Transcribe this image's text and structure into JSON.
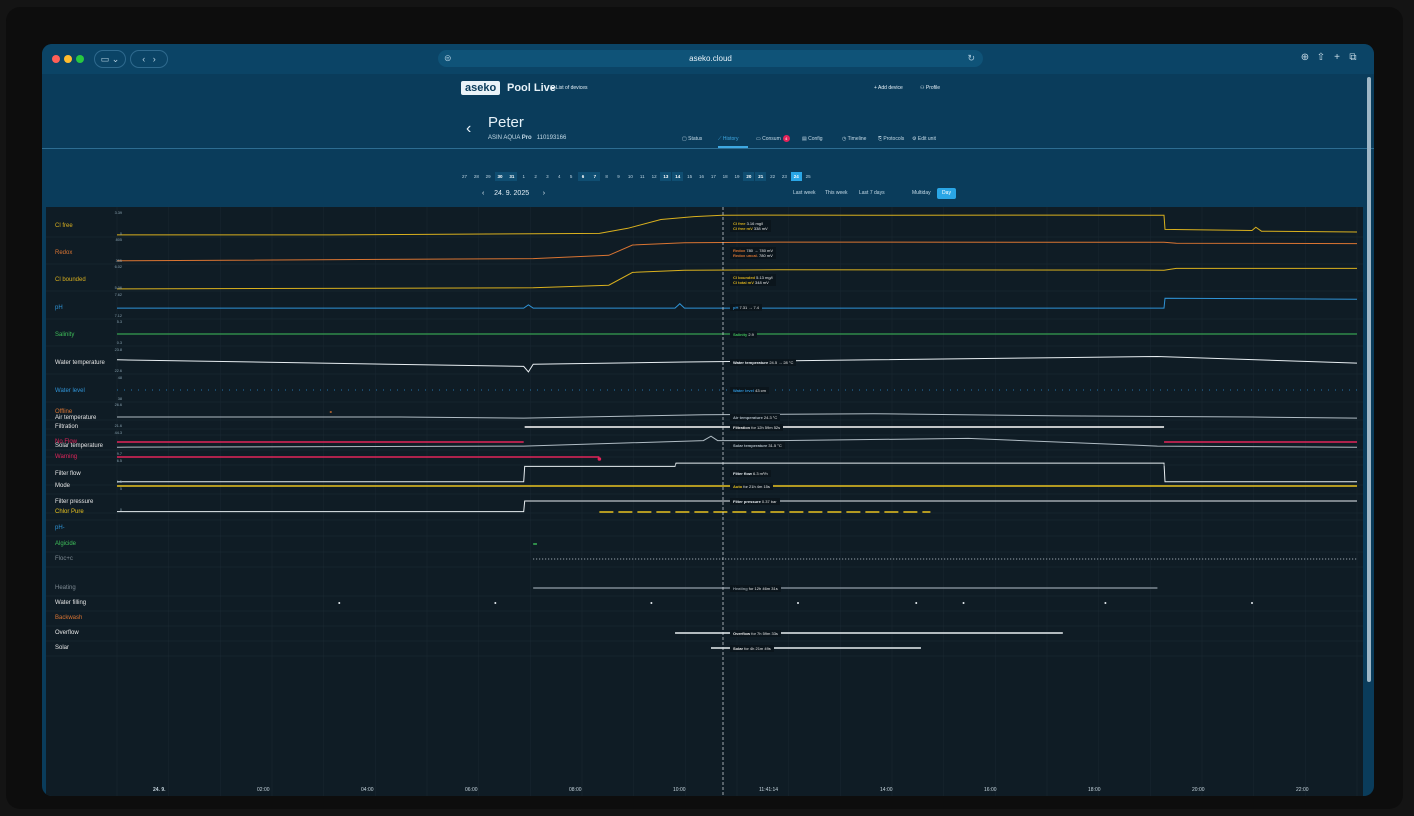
{
  "browser": {
    "url": "aseko.cloud"
  },
  "header": {
    "logo": "aseko",
    "brand": "Pool Live",
    "list_devices": "List of devices",
    "add_device": "+ Add device",
    "profile": "Profile"
  },
  "device": {
    "name": "Peter",
    "model_prefix": "ASIN AQUA",
    "model_bold": "Pro",
    "serial": "110193166"
  },
  "tabs": [
    {
      "label": "Status"
    },
    {
      "label": "History"
    },
    {
      "label": "Consum"
    },
    {
      "label": "Config"
    },
    {
      "label": "Timeline"
    },
    {
      "label": "Protocols"
    },
    {
      "label": "Edit unit"
    }
  ],
  "tabs_active": "History",
  "consum_badge": "4",
  "days": [
    "27",
    "28",
    "29",
    "30",
    "31",
    "1",
    "2",
    "3",
    "4",
    "5",
    "6",
    "7",
    "8",
    "9",
    "10",
    "11",
    "12",
    "13",
    "14",
    "15",
    "16",
    "17",
    "18",
    "19",
    "20",
    "21",
    "22",
    "23",
    "24",
    "25"
  ],
  "bold_days": [
    "30",
    "31",
    "6",
    "7",
    "13",
    "14",
    "20",
    "21"
  ],
  "selected_day": "24",
  "date": {
    "prev": "‹",
    "label": "24. 9. 2025",
    "next": "›"
  },
  "periods": {
    "last_week": "Last week",
    "this_week": "This week",
    "last7": "Last 7 days",
    "multiday": "Multiday",
    "day": "Day"
  },
  "series": [
    {
      "label": "Cl free",
      "color": "#d9b01e",
      "top": "3.39",
      "bottom": "0",
      "tag_name": "Cl free",
      "tag_val": "3.16 mg/l",
      "tag_name2": "Cl free mV",
      "tag_val2": "338 mV"
    },
    {
      "label": "Redox",
      "color": "#d97432",
      "top": "805",
      "bottom": "355",
      "tag_name": "Redox",
      "tag_val": "780 → 780 mV",
      "tag_name2": "Redox uncal.",
      "tag_val2": "780 mV"
    },
    {
      "label": "Cl bounded",
      "color": "#d9b01e",
      "top": "6.02",
      "bottom": "5.06",
      "tag_name": "Cl bounded",
      "tag_val": "5.13 mg/l",
      "tag_name2": "Cl total mV",
      "tag_val2": "348 mV"
    },
    {
      "label": "pH",
      "color": "#2f93d6",
      "top": "7.62",
      "bottom": "7.12",
      "tag_name": "pH",
      "tag_val": "7.31 → 7.4",
      "tag_name2": "",
      "tag_val2": ""
    },
    {
      "label": "Salinity",
      "color": "#3fbf5a",
      "top": "5.3",
      "bottom": "0.3",
      "tag_name": "Salinity",
      "tag_val": "2.9",
      "tag_name2": "",
      "tag_val2": ""
    },
    {
      "label": "Water temperature",
      "color": "#e8eef2",
      "top": "23.8",
      "bottom": "22.6",
      "tag_name": "Water temperature",
      "tag_val": "24.5 → 28 °C",
      "tag_name2": "",
      "tag_val2": ""
    },
    {
      "label": "Water level",
      "color": "#2f93d6",
      "top": "48",
      "bottom": "38",
      "tag_name": "Water level",
      "tag_val": "43 cm",
      "tag_name2": "",
      "tag_val2": ""
    },
    {
      "label": "Air temperature",
      "color": "#b0bcc4",
      "top": "26.6",
      "bottom": "21.6",
      "tag_name": "Air temperature",
      "tag_val": "24.3 °C",
      "tag_name2": "",
      "tag_val2": ""
    },
    {
      "label": "Solar temperature",
      "color": "#b0bcc4",
      "top": "44.3",
      "bottom": "9.7",
      "tag_name": "Solar temperature",
      "tag_val": "31.5 °C",
      "tag_name2": "",
      "tag_val2": ""
    },
    {
      "label": "Filter flow",
      "color": "#e8eef2",
      "top": "6.5",
      "bottom": "1.5",
      "tag_name": "Filter flow",
      "tag_val": "6.3 m³/h",
      "tag_name2": "",
      "tag_val2": ""
    },
    {
      "label": "Filter pressure",
      "color": "#e8eef2",
      "top": "5",
      "bottom": "0",
      "tag_name": "Filter pressure",
      "tag_val": "0.37 bar",
      "tag_name2": "",
      "tag_val2": ""
    }
  ],
  "states": [
    {
      "label": "Offline",
      "color": "#d97432",
      "tag": ""
    },
    {
      "label": "Filtration",
      "color": "#ffffff",
      "tag_name": "Filtration",
      "tag_val": "for 12h 59m 52s"
    },
    {
      "label": "No Flow",
      "color": "#e2245a",
      "tag": ""
    },
    {
      "label": "Warning",
      "color": "#e2245a",
      "tag": ""
    },
    {
      "label": "Mode",
      "color": "#e8c21e",
      "tag_name": "Auto",
      "tag_val": "for 21h 4m 15s"
    },
    {
      "label": "Chlor Pure",
      "color": "#e8c21e",
      "tag": ""
    },
    {
      "label": "pH-",
      "color": "#2f93d6",
      "tag": ""
    },
    {
      "label": "Algicide",
      "color": "#3fbf5a",
      "tag": ""
    },
    {
      "label": "Floc+c",
      "color": "#7e8a93",
      "tag": ""
    },
    {
      "label": "Heating",
      "color": "#7e8a93",
      "tag_name": "Heating",
      "tag_val": "for 12h 46m 31s"
    },
    {
      "label": "Water filling",
      "color": "#e8eef2",
      "tag": ""
    },
    {
      "label": "Backwash",
      "color": "#d97432",
      "tag": ""
    },
    {
      "label": "Overflow",
      "color": "#e8eef2",
      "tag_name": "Overflow",
      "tag_val": "for 7h 59m 33s"
    },
    {
      "label": "Solar",
      "color": "#e8eef2",
      "tag_name": "Solar",
      "tag_val": "for 4h 21m 49s"
    }
  ],
  "xaxis": [
    "24. 9.",
    "02:00",
    "04:00",
    "06:00",
    "08:00",
    "10:00",
    "11:41:14",
    "14:00",
    "16:00",
    "18:00",
    "20:00",
    "22:00"
  ]
}
